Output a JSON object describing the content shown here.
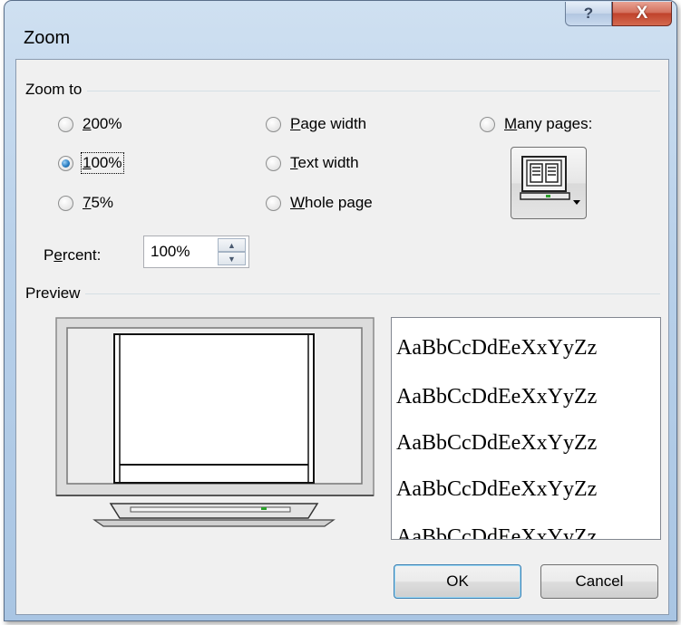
{
  "dialog": {
    "title": "Zoom",
    "help_label": "?",
    "close_label": "X"
  },
  "zoom_to": {
    "group_label": "Zoom to",
    "options": [
      {
        "label": "200%",
        "selected": false
      },
      {
        "label": "100%",
        "selected": true
      },
      {
        "label": "75%",
        "selected": false
      },
      {
        "label": "Page width",
        "selected": false
      },
      {
        "label": "Text width",
        "selected": false
      },
      {
        "label": "Whole page",
        "selected": false
      },
      {
        "label": "Many pages:",
        "selected": false
      }
    ],
    "many_pages_icon": "monitor-pages-icon",
    "percent_label": "Percent:",
    "percent_value": "100%"
  },
  "preview": {
    "group_label": "Preview",
    "sample_lines": [
      "AaBbCcDdEeXxYyZz",
      "AaBbCcDdEeXxYyZz",
      "AaBbCcDdEeXxYyZz",
      "AaBbCcDdEeXxYyZz",
      "AaBbCcDdEeXxYyZz"
    ]
  },
  "buttons": {
    "ok": "OK",
    "cancel": "Cancel"
  }
}
